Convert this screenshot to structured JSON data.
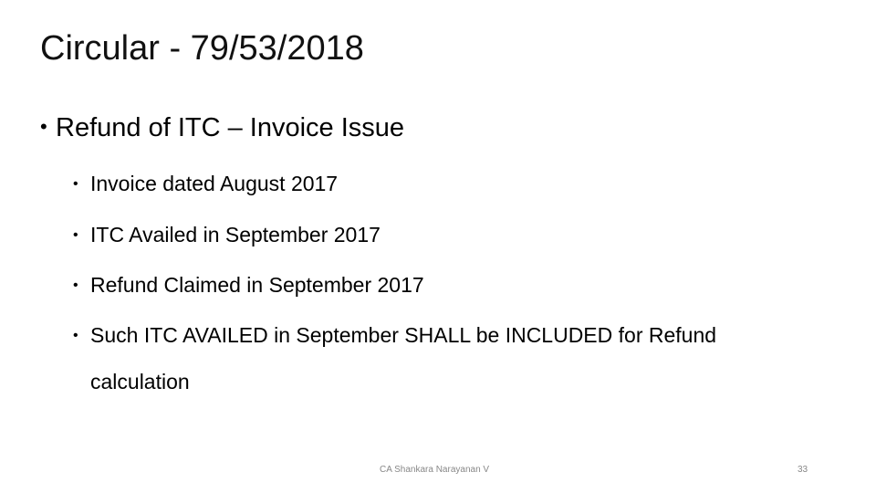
{
  "slide": {
    "title": "Circular - 79/53/2018",
    "main_bullet": "Refund of ITC – Invoice Issue",
    "sub_bullets": [
      "Invoice dated August 2017",
      "ITC Availed in September 2017",
      "Refund Claimed in September 2017",
      "Such ITC AVAILED in September SHALL be INCLUDED for Refund"
    ],
    "sub_bullet_continuation": "calculation",
    "bullet_glyph": "•"
  },
  "footer": {
    "author": "CA Shankara Narayanan V",
    "page_number": "33"
  }
}
